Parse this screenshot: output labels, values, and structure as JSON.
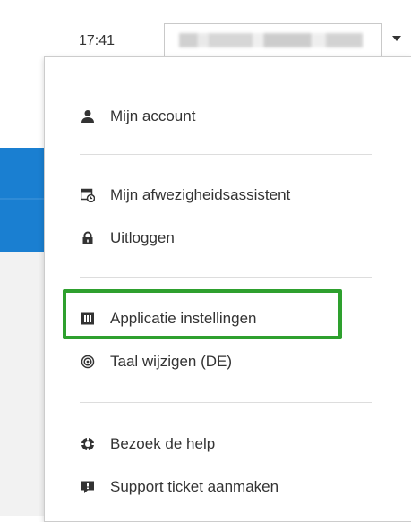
{
  "header": {
    "time": "17:41",
    "user_name": "",
    "dropdown_icon": "caret-down-icon"
  },
  "menu": {
    "groups": [
      {
        "items": [
          {
            "icon": "user-icon",
            "label": "Mijn account"
          }
        ]
      },
      {
        "items": [
          {
            "icon": "calendar-clock-icon",
            "label": "Mijn afwezigheidsassistent"
          },
          {
            "icon": "lock-icon",
            "label": "Uitloggen"
          }
        ]
      },
      {
        "items": [
          {
            "icon": "settings-grid-icon",
            "label": "Applicatie instellingen",
            "highlighted": true
          },
          {
            "icon": "target-icon",
            "label": "Taal wijzigen (DE)"
          }
        ]
      },
      {
        "items": [
          {
            "icon": "help-life-ring-icon",
            "label": "Bezoek de help"
          },
          {
            "icon": "support-ticket-icon",
            "label": "Support ticket aanmaken"
          }
        ]
      }
    ]
  },
  "colors": {
    "accent_blue": "#1a7fd1",
    "highlight_green": "#2ea02e",
    "text": "#333333"
  }
}
